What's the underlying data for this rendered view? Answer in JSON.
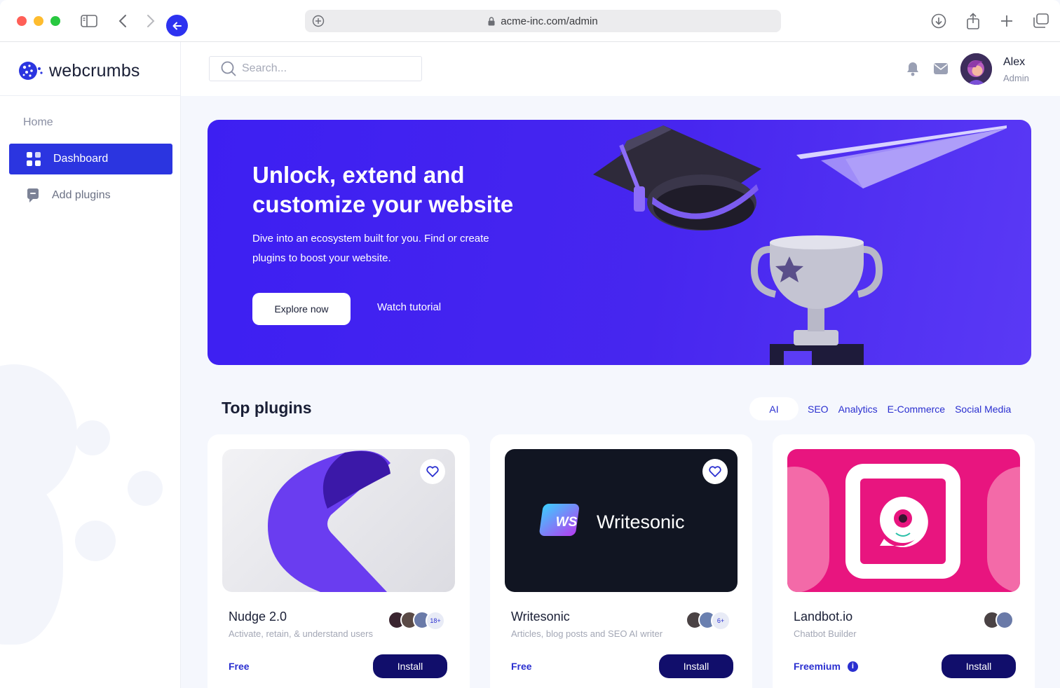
{
  "browser": {
    "url": "acme-inc.com/admin"
  },
  "sidebar": {
    "brand": "webcrumbs",
    "heading": "Home",
    "items": [
      {
        "label": "Dashboard",
        "icon": "grid-icon",
        "active": true
      },
      {
        "label": "Add plugins",
        "icon": "bookmark-icon",
        "active": false
      }
    ]
  },
  "topbar": {
    "search_placeholder": "Search...",
    "user": {
      "name": "Alex",
      "role": "Admin"
    }
  },
  "hero": {
    "title": "Unlock, extend and customize your website",
    "subtitle": "Dive into an ecosystem built for you. Find or create plugins to boost your website.",
    "primary_button": "Explore now",
    "secondary_button": "Watch tutorial"
  },
  "plugins": {
    "title": "Top plugins",
    "filters": [
      "AI",
      "SEO",
      "Analytics",
      "E-Commerce",
      "Social Media"
    ],
    "active_filter": "AI",
    "cards": [
      {
        "name": "Nudge 2.0",
        "description": "Activate, retain, & understand users",
        "price": "Free",
        "install": "Install",
        "users_extra": "18+",
        "favorite": true
      },
      {
        "name": "Writesonic",
        "description": "Articles, blog posts and SEO AI writer",
        "price": "Free",
        "install": "Install",
        "users_extra": "6+",
        "favorite": true,
        "logo_badge": "WS",
        "logo_text": "Writesonic"
      },
      {
        "name": "Landbot.io",
        "description": "Chatbot Builder",
        "price": "Freemium",
        "install": "Install",
        "users_extra": "",
        "favorite": false
      }
    ]
  },
  "colors": {
    "primary": "#2b35e0",
    "hero_bg": "#4726ef",
    "install_btn": "#110e6b",
    "landbot_pink": "#e8157f"
  }
}
